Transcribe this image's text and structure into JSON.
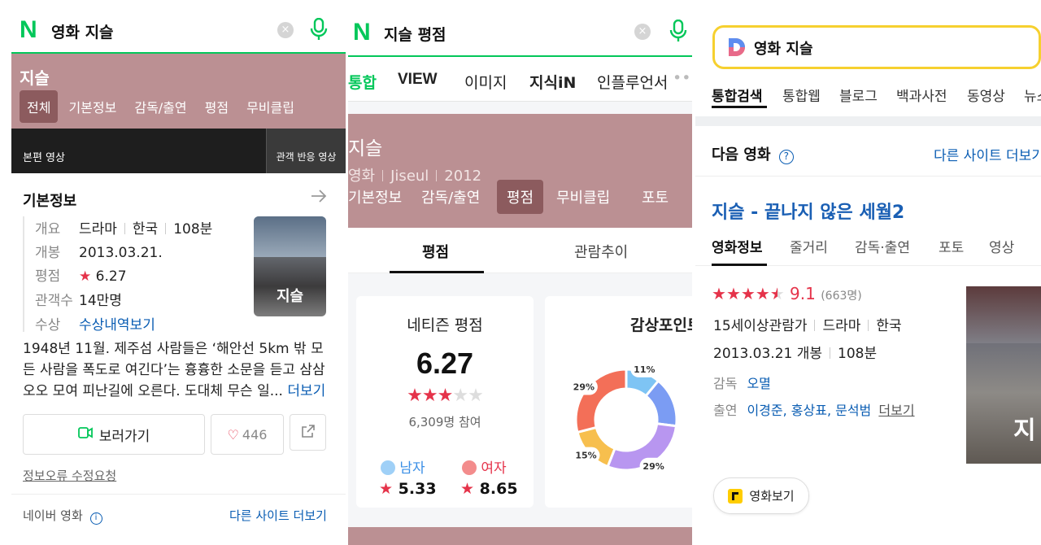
{
  "naver_movie": {
    "query": "영화 지슬",
    "title": "지슬",
    "tabs": [
      "전체",
      "기본정보",
      "감독/출연",
      "평점",
      "무비클립"
    ],
    "video_main": "본편 영상",
    "video_reaction": "관객 반응 영상",
    "section_title": "기본정보",
    "info": {
      "overview_label": "개요",
      "genre": "드라마",
      "country": "한국",
      "runtime": "108분",
      "release_label": "개봉",
      "release": "2013.03.21.",
      "rating_label": "평점",
      "rating": "6.27",
      "audience_label": "관객수",
      "audience": "14만명",
      "award_label": "수상",
      "award_link": "수상내역보기"
    },
    "poster_title": "지슬",
    "synopsis": "1948년 11월. 제주섬 사람들은 ‘해안선 5km 밖 모든 사람을 폭도로 여긴다’는 흉흉한 소문을 듣고 삼삼오오 모여 피난길에 오른다. 도대체 무슨 일...",
    "more": "더보기",
    "watch_button": "보러가기",
    "like_count": "446",
    "report_link": "정보오류 수정요청",
    "footer_source": "네이버 영화",
    "footer_more": "다른 사이트 더보기"
  },
  "naver_rating": {
    "query": "지슬 평점",
    "top_tabs": [
      "통합",
      "VIEW",
      "이미지",
      "지식iN",
      "인플루언서"
    ],
    "title": "지슬",
    "sub_type": "영화",
    "sub_title_en": "Jiseul",
    "sub_year": "2012",
    "tabs": [
      "기본정보",
      "감독/출연",
      "평점",
      "무비클립",
      "포토"
    ],
    "sub_tabs": [
      "평점",
      "관람추이"
    ],
    "netizen_title": "네티즌 평점",
    "score": "6.27",
    "stars": 3,
    "participants": "6,309명 참여",
    "male_label": "남자",
    "male_score": "5.33",
    "female_label": "여자",
    "female_score": "8.65",
    "point_title": "감상포인트",
    "donut": {
      "segments": [
        {
          "value": 11,
          "color": "#7ec4f4",
          "label": "11%"
        },
        {
          "value": 16,
          "color": "#7b9cf3",
          "label": ""
        },
        {
          "value": 29,
          "color": "#b896f0",
          "label": "29%"
        },
        {
          "value": 15,
          "color": "#f7bf4e",
          "label": "15%"
        },
        {
          "value": 29,
          "color": "#f36f58",
          "label": "29%"
        }
      ]
    }
  },
  "daum_movie": {
    "query": "영화 지슬",
    "tabs": [
      "통합검색",
      "통합웹",
      "블로그",
      "백과사전",
      "동영상",
      "뉴스"
    ],
    "section": "다음 영화",
    "other_sites": "다른 사이트 더보기",
    "movie_title": "지슬 - 끝나지 않은 세월2",
    "movie_tabs": [
      "영화정보",
      "줄거리",
      "감독·출연",
      "포토",
      "영상"
    ],
    "rating": "9.1",
    "rating_count": "(663명)",
    "stars": 4.5,
    "age": "15세이상관람가",
    "genre": "드라마",
    "country": "한국",
    "release": "2013.03.21 개봉",
    "runtime": "108분",
    "director_label": "감독",
    "director": "오멸",
    "cast_label": "출연",
    "cast": "이경준, 홍상표, 문석범",
    "cast_more": "더보기",
    "watch_button": "영화보기",
    "poster_title": "지"
  },
  "colors": {
    "naver_green": "#03c75a",
    "tint": "#bb9093",
    "tint_active": "#8c5b5e",
    "daum_yellow": "#f6d02f",
    "link_blue": "#0a5db3",
    "star_red": "#e5334a"
  }
}
